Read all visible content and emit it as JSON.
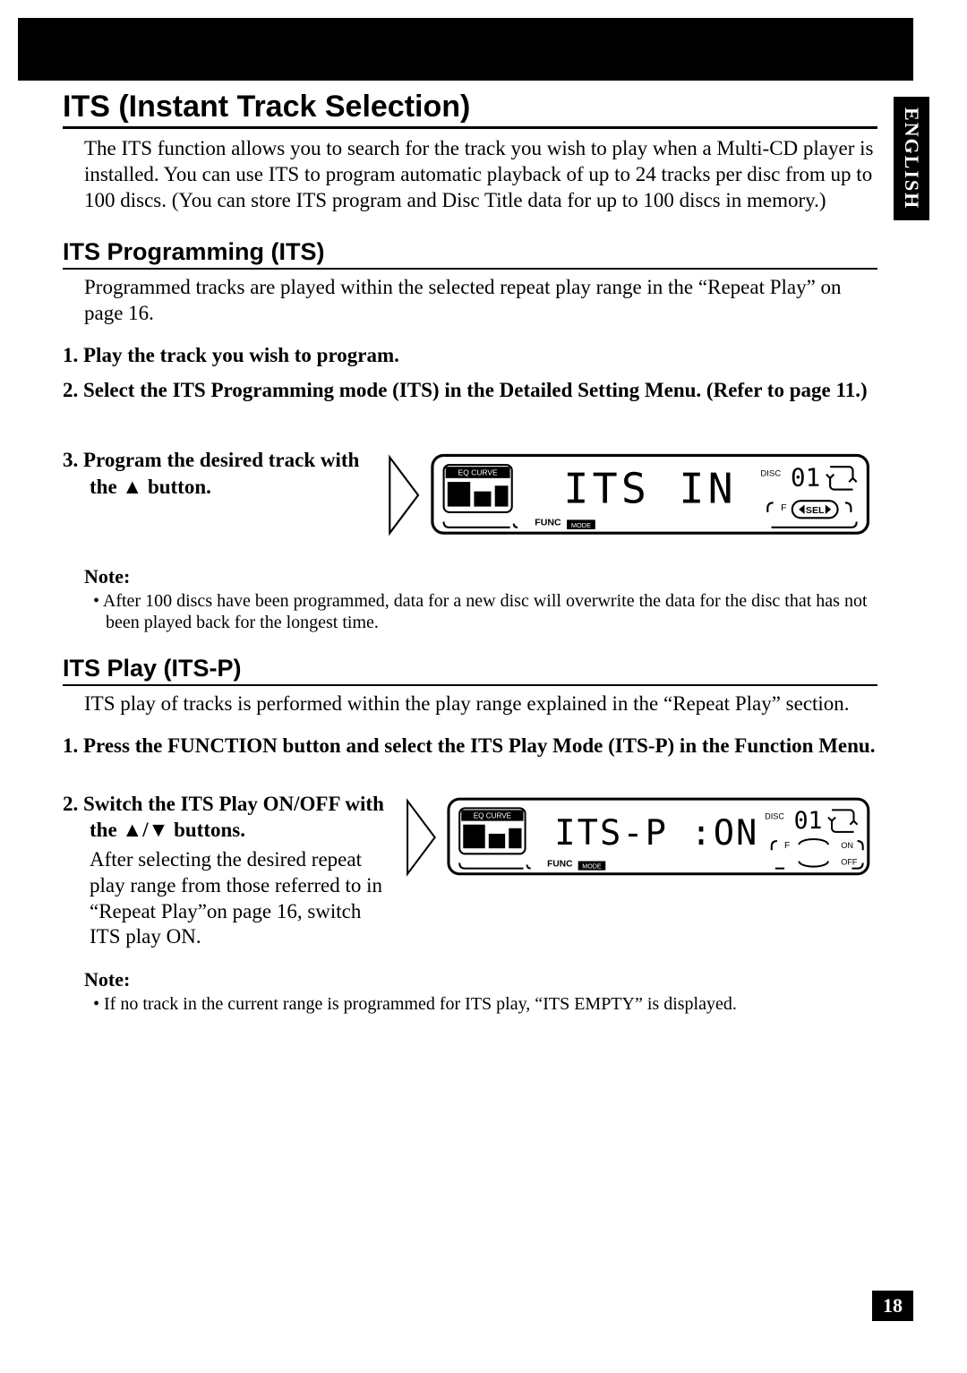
{
  "language_tab": "ENGLISH",
  "page_number": "18",
  "section1": {
    "title": "ITS (Instant Track Selection)",
    "intro": "The ITS function allows you to search for the track you wish to play when a Multi-CD player is installed. You can use ITS to program automatic playback of up to 24 tracks per disc from up to 100 discs. (You can store ITS program and Disc Title data for up to 100 discs in memory.)"
  },
  "section2": {
    "title": "ITS Programming (ITS)",
    "intro": "Programmed tracks are played within the selected repeat play range in the “Repeat Play” on page 16.",
    "step1": "1.  Play the track you wish to program.",
    "step2": "2.  Select the ITS Programming mode (ITS) in the Detailed Setting Menu. (Refer to page 11.)",
    "step3_pre": "3.  Program the desired track with the ",
    "step3_post": " button.",
    "note_label": "Note:",
    "note1": "• After 100 discs have been programmed, data for a new disc will overwrite the data for the disc that has not been played back for the longest time."
  },
  "section3": {
    "title": "ITS Play (ITS-P)",
    "intro": "ITS play of tracks is performed within the play range explained in the “Repeat Play” section.",
    "step1": "1.  Press the FUNCTION button and select the ITS Play Mode (ITS-P) in the Function Menu.",
    "step2_pre": "2.  Switch the ITS Play ON/OFF with the ",
    "step2_post": " buttons.",
    "step2_after": "After selecting the desired repeat play range from those referred to in “Repeat Play”on page 16, switch ITS play ON.",
    "note_label": "Note:",
    "note1": "• If no track in the current range is programmed for ITS play, “ITS EMPTY” is displayed."
  },
  "display1": {
    "eq_label": "EQ CURVE",
    "func_label": "FUNC",
    "mode_label": "MODE",
    "main_text": "ITS IN",
    "disc_label": "DISC",
    "disc_num": "01",
    "sel_label": "SEL"
  },
  "display2": {
    "eq_label": "EQ CURVE",
    "func_label": "FUNC",
    "mode_label": "MODE",
    "main_text": "ITS-P :ON",
    "disc_label": "DISC",
    "disc_num": "01",
    "on_label": "ON",
    "off_label": "OFF"
  }
}
